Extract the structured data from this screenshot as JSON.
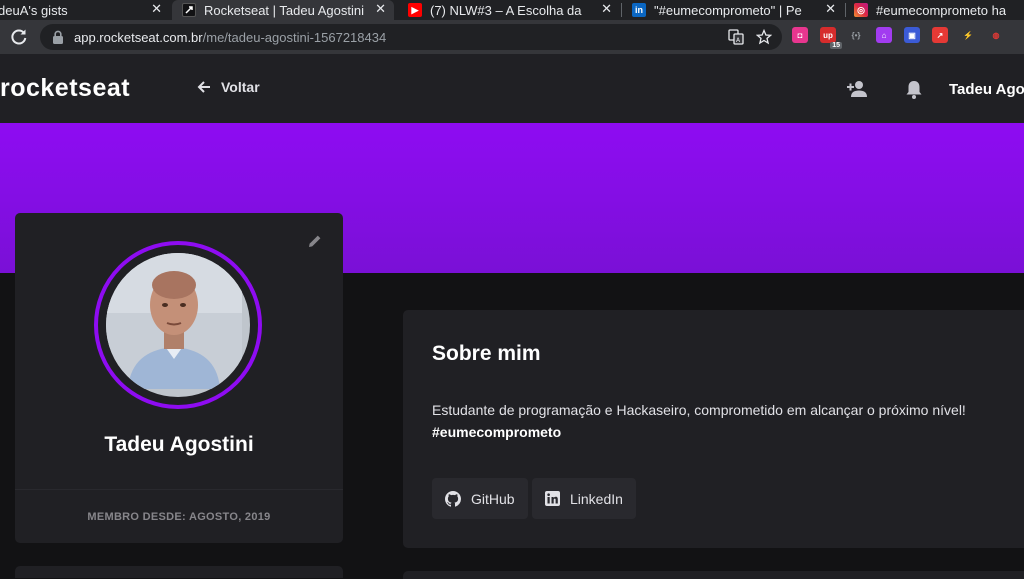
{
  "browser": {
    "tabs": [
      {
        "title": "deuA's gists",
        "active": false
      },
      {
        "title": "Rocketseat | Tadeu Agostini",
        "active": true
      },
      {
        "title": "(7) NLW#3 – A Escolha da",
        "active": false
      },
      {
        "title": "\"#eumecomprometo\" | Pe",
        "active": false
      },
      {
        "title": "#eumecomprometo ha",
        "active": false
      }
    ],
    "close_glyph": "✕",
    "url_host": "app.rocketseat.com.br",
    "url_path": "/me/tadeu-agostini-1567218434",
    "extension_badge": "15"
  },
  "header": {
    "logo": "rocketseat",
    "back_label": "Voltar",
    "user_name": "Tadeu Agostini"
  },
  "profile": {
    "name": "Tadeu Agostini",
    "member_since": "MEMBRO DESDE: AGOSTO, 2019"
  },
  "about": {
    "title": "Sobre mim",
    "text": "Estudante de programação e Hackaseiro, comprometido em alcançar o próximo nível!",
    "tag": "#eumecomprometo",
    "buttons": [
      {
        "label": "GitHub",
        "icon": "github-icon"
      },
      {
        "label": "LinkedIn",
        "icon": "linkedin-icon"
      }
    ]
  },
  "colors": {
    "brand_purple": "#8e0cf2",
    "background": "#121214",
    "card": "#202024"
  }
}
